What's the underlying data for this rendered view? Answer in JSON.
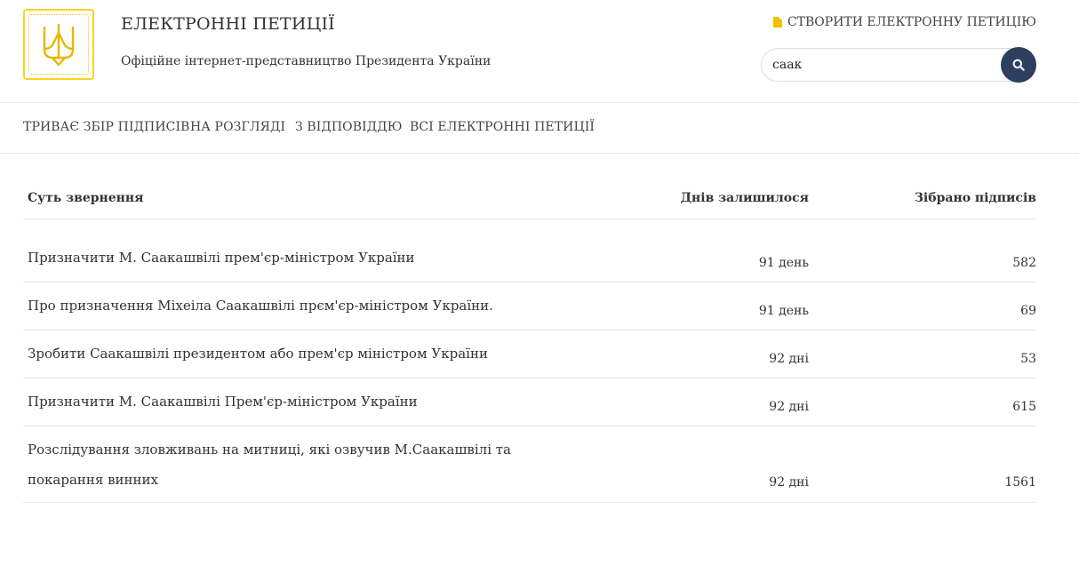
{
  "header": {
    "title": "ЕЛЕКТРОННІ ПЕТИЦІЇ",
    "subtitle": "Офіційне інтернет-представництво Президента України",
    "create_link": "СТВОРИТИ ЕЛЕКТРОННУ ПЕТИЦІЮ",
    "search_value": "саак",
    "accent_color": "#ffd21f",
    "search_button_color": "#2d3e5f"
  },
  "nav": {
    "items": [
      {
        "label": "ТРИВАЄ ЗБІР ПІДПИСІВ"
      },
      {
        "label": "НА РОЗГЛЯДІ"
      },
      {
        "label": "З ВІДПОВІДДЮ"
      },
      {
        "label": "ВСІ ЕЛЕКТРОННІ ПЕТИЦІЇ"
      }
    ]
  },
  "table": {
    "columns": [
      "Суть звернення",
      "Днів залишилося",
      "Зібрано підписів"
    ],
    "rows": [
      {
        "title": "Призначити М. Саакашвілі прем'єр-міністром України",
        "days": "91 день",
        "count": "582"
      },
      {
        "title": "Про призначення Міхеіла Саакашвілі прєм'єр-міністром України.",
        "days": "91 день",
        "count": "69"
      },
      {
        "title": "Зробити Саакашвілі президентом або прем'єр міністром України",
        "days": "92 дні",
        "count": "53"
      },
      {
        "title": "Призначити М. Саакашвілі Прем'єр-міністром України",
        "days": "92 дні",
        "count": "615"
      },
      {
        "title": "Розслідування зловживань на митниці, які озвучив М.Саакашвілі та покарання винних",
        "days": "92 дні",
        "count": "1561"
      }
    ]
  }
}
